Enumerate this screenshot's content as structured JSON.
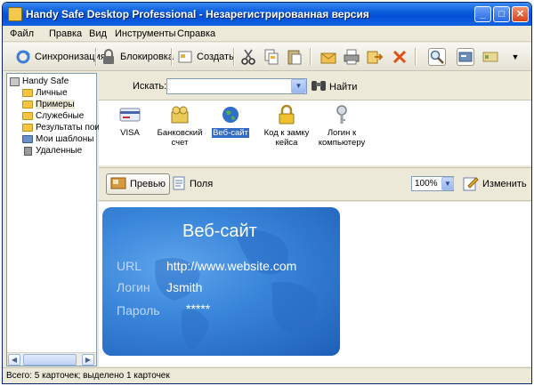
{
  "window": {
    "title": "Handy Safe Desktop Professional - Незарегистрированная версия",
    "minimize": "_",
    "maximize": "□",
    "close": "✕"
  },
  "menu": [
    "Файл",
    "Правка",
    "Вид",
    "Инструменты",
    "Справка"
  ],
  "toolbar": {
    "sync": "Синхронизация",
    "lock": "Блокировка",
    "create": "Создать"
  },
  "tree": {
    "root": "Handy Safe",
    "items": [
      "Личные",
      "Примеры",
      "Служебные",
      "Результаты пои",
      "Мои шаблоны",
      "Удаленные"
    ],
    "selected_index": 1
  },
  "search": {
    "label": "Искать:",
    "value": "",
    "find_button": "Найти"
  },
  "cards": [
    {
      "label": "VISA",
      "icon": "visa-card-icon",
      "selected": false
    },
    {
      "label": "Банковский\nсчет",
      "icon": "bank-account-icon",
      "selected": false
    },
    {
      "label": "Веб-сайт",
      "icon": "globe-icon",
      "selected": true
    },
    {
      "label": "Код к замку\nкейса",
      "icon": "padlock-icon",
      "selected": false
    },
    {
      "label": "Логин к\nкомпьютеру",
      "icon": "key-icon",
      "selected": false
    }
  ],
  "viewbar": {
    "preview": "Превью",
    "fields": "Поля",
    "zoom": "100%",
    "edit": "Изменить"
  },
  "card_preview": {
    "title": "Веб-сайт",
    "fields": [
      {
        "label": "URL",
        "value": "http://www.website.com"
      },
      {
        "label": "Логин",
        "value": "Jsmith"
      },
      {
        "label": "Пароль",
        "value": "*****"
      }
    ]
  },
  "status": "Всего: 5 карточек; выделено 1 карточек"
}
